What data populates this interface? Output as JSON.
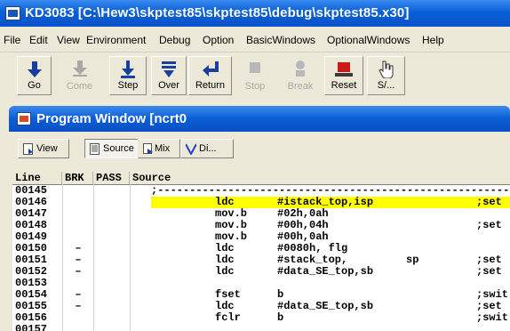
{
  "window": {
    "title": "KD3083 [C:\\Hew3\\skptest85\\skptest85\\debug\\skptest85.x30]"
  },
  "menu": [
    "File",
    "Edit",
    "View",
    "Environment",
    "Debug",
    "Option",
    "BasicWindows",
    "OptionalWindows",
    "Help"
  ],
  "toolbar": [
    {
      "label": "Go",
      "icon": "arrow-down-icon",
      "enabled": true
    },
    {
      "label": "Come",
      "icon": "arrow-down-bar-icon",
      "enabled": false
    },
    {
      "label": "Step",
      "icon": "step-icon",
      "enabled": true
    },
    {
      "label": "Over",
      "icon": "step-over-icon",
      "enabled": true
    },
    {
      "label": "Return",
      "icon": "return-icon",
      "enabled": true
    },
    {
      "label": "Stop",
      "icon": "stop-icon",
      "enabled": false
    },
    {
      "label": "Break",
      "icon": "break-icon",
      "enabled": false
    },
    {
      "label": "Reset",
      "icon": "reset-icon",
      "enabled": true
    },
    {
      "label": "S/...",
      "icon": "hand-icon",
      "enabled": true
    }
  ],
  "program_window": {
    "title": "Program Window [ncrt0",
    "view_buttons": [
      {
        "label": "View",
        "icon": "view-icon"
      },
      {
        "label": "Source",
        "icon": "source-icon",
        "pressed": true
      },
      {
        "label": "Mix",
        "icon": "mix-icon"
      },
      {
        "label": "Di...",
        "icon": "disasm-icon"
      }
    ],
    "columns": [
      "Line",
      "BRK",
      "PASS",
      "Source"
    ],
    "rows": [
      {
        "line": "00145",
        "brk": "",
        "mnemonic": "",
        "operand": "",
        "operand2": "",
        "comment": "",
        "dashes": ";----------------------------------------------------------",
        "highlight": false
      },
      {
        "line": "00146",
        "brk": "",
        "mnemonic": "ldc",
        "operand": "#istack_top,isp",
        "operand2": "",
        "comment": ";set",
        "dashes": "",
        "highlight": true
      },
      {
        "line": "00147",
        "brk": "",
        "mnemonic": "mov.b",
        "operand": "#02h,0ah",
        "operand2": "",
        "comment": "",
        "dashes": "",
        "highlight": false
      },
      {
        "line": "00148",
        "brk": "",
        "mnemonic": "mov.b",
        "operand": "#00h,04h",
        "operand2": "",
        "comment": ";set",
        "dashes": "",
        "highlight": false
      },
      {
        "line": "00149",
        "brk": "",
        "mnemonic": "mov.b",
        "operand": "#00h,0ah",
        "operand2": "",
        "comment": "",
        "dashes": "",
        "highlight": false
      },
      {
        "line": "00150",
        "brk": "–",
        "mnemonic": "ldc",
        "operand": "#0080h, flg",
        "operand2": "",
        "comment": "",
        "dashes": "",
        "highlight": false
      },
      {
        "line": "00151",
        "brk": "–",
        "mnemonic": "ldc",
        "operand": "#stack_top,",
        "operand2": "sp",
        "comment": ";set",
        "dashes": "",
        "highlight": false
      },
      {
        "line": "00152",
        "brk": "–",
        "mnemonic": "ldc",
        "operand": "#data_SE_top,sb",
        "operand2": "",
        "comment": ";set",
        "dashes": "",
        "highlight": false
      },
      {
        "line": "00153",
        "brk": "",
        "mnemonic": "",
        "operand": "",
        "operand2": "",
        "comment": "",
        "dashes": "",
        "highlight": false
      },
      {
        "line": "00154",
        "brk": "–",
        "mnemonic": "fset",
        "operand": "b",
        "operand2": "",
        "comment": ";swit",
        "dashes": "",
        "highlight": false
      },
      {
        "line": "00155",
        "brk": "–",
        "mnemonic": "ldc",
        "operand": "#data_SE_top,sb",
        "operand2": "",
        "comment": ";set",
        "dashes": "",
        "highlight": false
      },
      {
        "line": "00156",
        "brk": "",
        "mnemonic": "fclr",
        "operand": "b",
        "operand2": "",
        "comment": ";swit",
        "dashes": "",
        "highlight": false
      },
      {
        "line": "00157",
        "brk": "",
        "mnemonic": "",
        "operand": "",
        "operand2": "",
        "comment": "",
        "dashes": "",
        "highlight": false
      }
    ]
  },
  "colors": {
    "titlebar": "#0a5fd8",
    "highlight": "#ffff00",
    "toolbar_bg": "#ece9d8",
    "reset_red": "#d01818"
  }
}
